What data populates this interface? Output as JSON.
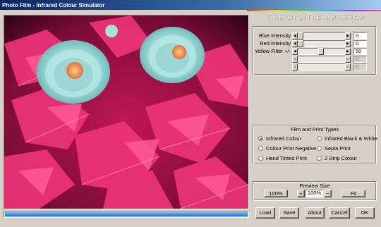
{
  "window": {
    "title": "Photo Film - Infrared Colour Simulator"
  },
  "brand": {
    "text": "THE DIGITAL ARTSHOP"
  },
  "sliders": [
    {
      "label": "Blue Intensity",
      "value": "0",
      "position": 0.0,
      "enabled": true
    },
    {
      "label": "Red Intensity",
      "value": "0",
      "position": 0.0,
      "enabled": true
    },
    {
      "label": "Yellow Filter +/-",
      "value": "50",
      "position": 0.5,
      "enabled": true
    },
    {
      "label": "",
      "value": "0",
      "position": 0.0,
      "enabled": false
    },
    {
      "label": "",
      "value": "0",
      "position": 0.0,
      "enabled": false
    }
  ],
  "film_types": {
    "title": "Film and Print Types",
    "options": [
      {
        "label": "Infrared Colour",
        "checked": true
      },
      {
        "label": "Infrared Black & White",
        "checked": false
      },
      {
        "label": "Colour Print Negative",
        "checked": false
      },
      {
        "label": "Sepia Print",
        "checked": false
      },
      {
        "label": "Hand Tinted Print",
        "checked": false
      },
      {
        "label": "2 Strip Colour",
        "checked": false
      }
    ]
  },
  "preview": {
    "title": "Preview Size",
    "reset_label": "100%",
    "plus_label": "+",
    "value": "100%",
    "minus_label": "−",
    "fit_label": "Fit"
  },
  "progress": {
    "fraction": 1.0
  },
  "buttons": {
    "load": "Load",
    "save": "Save",
    "about": "About",
    "cancel": "Cancel",
    "ok": "OK"
  },
  "colors": {
    "foliage": "#e8306e",
    "flower": "#a8e0dc",
    "flower_center": "#f0a060"
  }
}
